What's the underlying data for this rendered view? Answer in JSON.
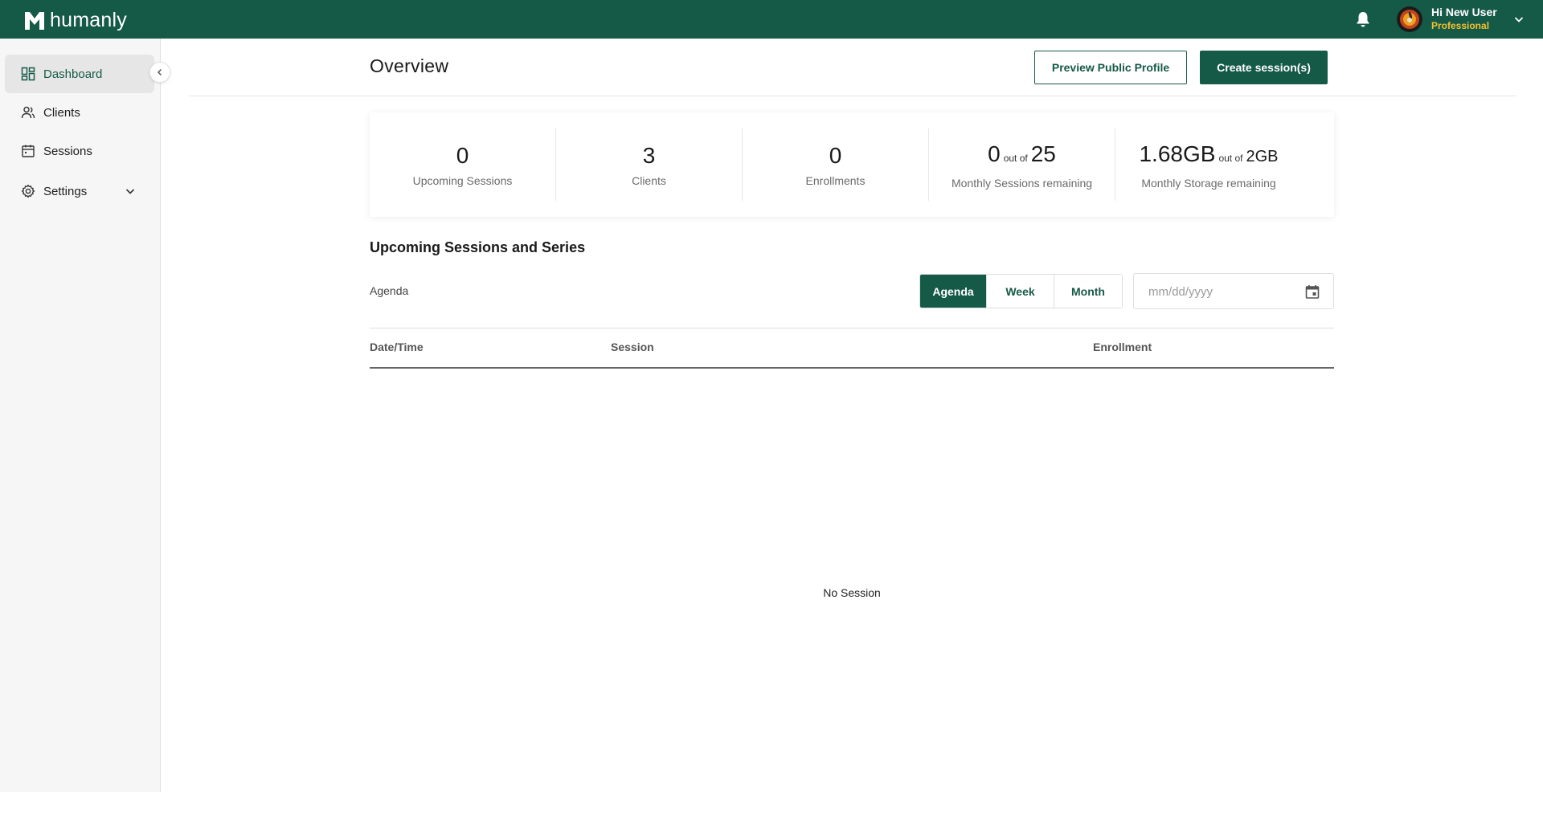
{
  "brand": {
    "name": "humanly",
    "color": "#155947"
  },
  "user": {
    "greeting": "Hi New User",
    "plan": "Professional",
    "plan_color": "#f2c230"
  },
  "sidebar": {
    "items": [
      {
        "label": "Dashboard",
        "icon": "dashboard-icon",
        "active": true
      },
      {
        "label": "Clients",
        "icon": "users-icon"
      },
      {
        "label": "Sessions",
        "icon": "calendar-icon"
      },
      {
        "label": "Settings",
        "icon": "gear-icon",
        "expandable": true
      }
    ]
  },
  "header": {
    "title": "Overview",
    "preview_button": "Preview Public Profile",
    "create_button": "Create session(s)"
  },
  "stats": [
    {
      "value": "0",
      "label": "Upcoming Sessions"
    },
    {
      "value": "3",
      "label": "Clients"
    },
    {
      "value": "0",
      "label": "Enrollments"
    },
    {
      "value": "0",
      "out_of": "out of",
      "total": "25",
      "label": "Monthly Sessions remaining"
    },
    {
      "value": "1.68GB",
      "out_of": "out of",
      "total": "2GB",
      "label": "Monthly Storage remaining"
    }
  ],
  "sessions": {
    "title": "Upcoming Sessions and Series",
    "current_view": "Agenda",
    "views": [
      "Agenda",
      "Week",
      "Month"
    ],
    "date_placeholder": "mm/dd/yyyy",
    "columns": [
      "Date/Time",
      "Session",
      "Enrollment"
    ],
    "empty_text": "No Session"
  }
}
